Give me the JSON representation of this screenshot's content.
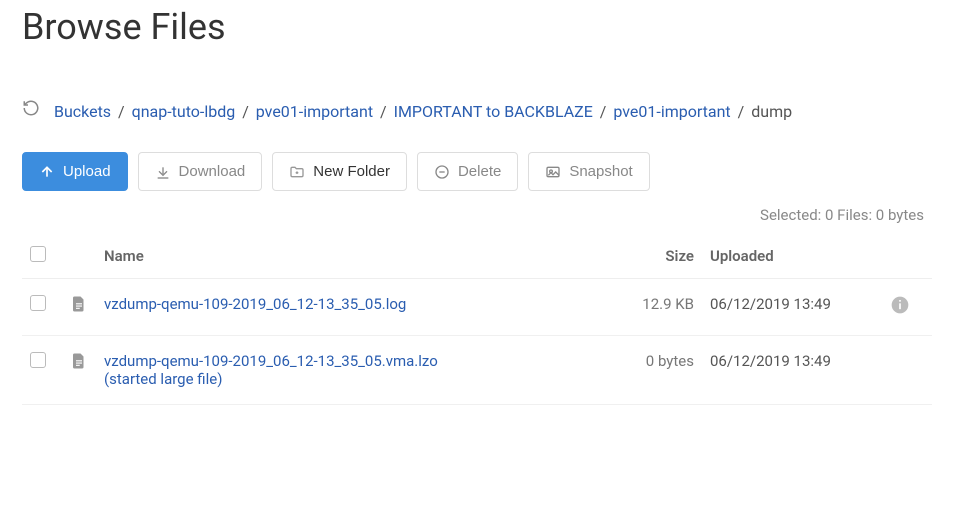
{
  "title": "Browse Files",
  "breadcrumb": {
    "items": [
      "Buckets",
      "qnap-tuto-lbdg",
      "pve01-important",
      "IMPORTANT to BACKBLAZE",
      "pve01-important"
    ],
    "current": "dump"
  },
  "toolbar": {
    "upload": "Upload",
    "download": "Download",
    "new_folder": "New Folder",
    "delete": "Delete",
    "snapshot": "Snapshot"
  },
  "status": "Selected: 0 Files: 0 bytes",
  "columns": {
    "name": "Name",
    "size": "Size",
    "uploaded": "Uploaded"
  },
  "files": [
    {
      "name": "vzdump-qemu-109-2019_06_12-13_35_05.log",
      "subtext": "",
      "size": "12.9 KB",
      "uploaded": "06/12/2019 13:49",
      "has_info": true
    },
    {
      "name": "vzdump-qemu-109-2019_06_12-13_35_05.vma.lzo",
      "subtext": "(started large file)",
      "size": "0 bytes",
      "uploaded": "06/12/2019 13:49",
      "has_info": false
    }
  ]
}
